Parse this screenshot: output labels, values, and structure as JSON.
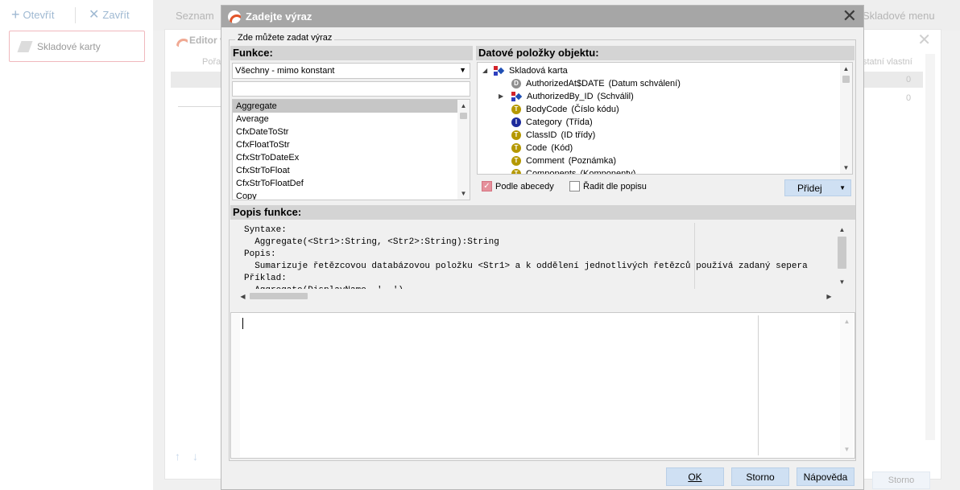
{
  "toolbar": {
    "open_label": "Otevřít",
    "close_label": "Zavřít"
  },
  "left_tile": {
    "label": "Skladové karty"
  },
  "bg_tabs": {
    "list": "Seznam",
    "menu": "Skladové menu"
  },
  "editor": {
    "title": "Editor v",
    "col_order": "Pořa",
    "col_custom": "statní vlastní",
    "val1": "0",
    "val2": "0",
    "cancel": "Storno"
  },
  "dialog": {
    "title": "Zadejte výraz",
    "group_label": "Zde můžete zadat výraz",
    "functions": {
      "header": "Funkce:",
      "filter_value": "Všechny - mimo konstant",
      "search_value": "",
      "items": [
        "Aggregate",
        "Average",
        "CfxDateToStr",
        "CfxFloatToStr",
        "CfxStrToDateEx",
        "CfxStrToFloat",
        "CfxStrToFloatDef",
        "Copy"
      ],
      "selected": "Aggregate"
    },
    "data_items": {
      "header": "Datové položky objektu:",
      "root": "Skladová karta",
      "rows": [
        {
          "icon": "D",
          "name": "AuthorizedAt$DATE",
          "desc": "(Datum schválení)"
        },
        {
          "icon": "OBJ",
          "name": "AuthorizedBy_ID",
          "desc": "(Schválil)"
        },
        {
          "icon": "T",
          "name": "BodyCode",
          "desc": "(Číslo kódu)"
        },
        {
          "icon": "I",
          "name": "Category",
          "desc": "(Třída)"
        },
        {
          "icon": "T",
          "name": "ClassID",
          "desc": "(ID třídy)"
        },
        {
          "icon": "T",
          "name": "Code",
          "desc": "(Kód)"
        },
        {
          "icon": "T",
          "name": "Comment",
          "desc": "(Poznámka)"
        },
        {
          "icon": "T",
          "name": "Components",
          "desc": "(Komponenty)"
        }
      ],
      "sort_alpha_label": "Podle abecedy",
      "sort_alpha_checked": true,
      "sort_desc_label": "Řadit dle popisu",
      "sort_desc_checked": false,
      "add_label": "Přidej"
    },
    "description": {
      "header": "Popis funkce:",
      "lines": [
        "Syntaxe:",
        "  Aggregate(<Str1>:String, <Str2>:String):String",
        "Popis:",
        "  Sumarizuje řetězcovou databázovou položku <Str1> a k oddělení jednotlivých řetězců používá zadaný sepera",
        "Příklad:",
        "  Aggregate(DisplayName, ', ')"
      ]
    },
    "expression": {
      "value": ""
    },
    "buttons": {
      "ok": "OK",
      "cancel": "Storno",
      "help": "Nápověda"
    }
  }
}
